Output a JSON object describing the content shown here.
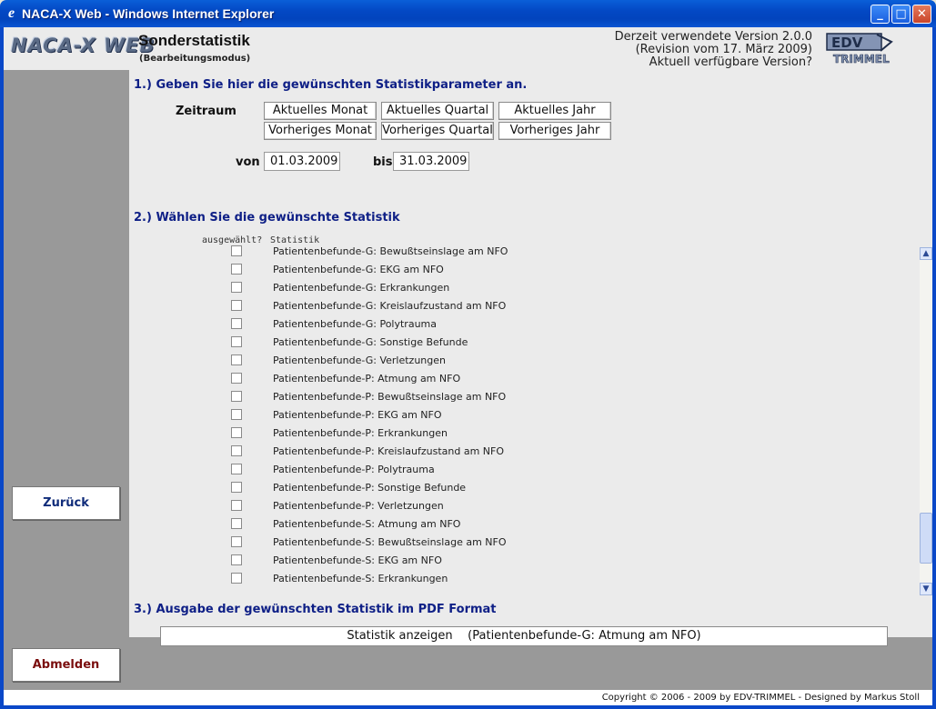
{
  "window": {
    "title": "NACA-X Web - Windows Internet Explorer"
  },
  "header": {
    "logo_text": "NACA-X WEB",
    "title": "Sonderstatistik",
    "subtitle": "(Bearbeitungsmodus)",
    "version_line1": "Derzeit verwendete Version 2.0.0",
    "version_line2": "(Revision vom 17. März 2009)",
    "version_line3": "Aktuell verfügbare Version?",
    "edv_logo_text": "EDV",
    "edv_logo_sub": "TRIMMEL"
  },
  "sidebar": {
    "back_label": "Zurück",
    "logout_label": "Abmelden"
  },
  "section1": {
    "heading": "1.) Geben Sie hier die gewünschten Statistikparameter an.",
    "zeitraum_label": "Zeitraum",
    "buttons": {
      "current_month": "Aktuelles Monat",
      "current_quarter": "Aktuelles Quartal",
      "current_year": "Aktuelles Jahr",
      "prev_month": "Vorheriges Monat",
      "prev_quarter": "Vorheriges Quartal",
      "prev_year": "Vorheriges Jahr"
    },
    "from_label": "von",
    "from_value": "01.03.2009",
    "to_label": "bis",
    "to_value": "31.03.2009"
  },
  "section2": {
    "heading": "2.) Wählen Sie die gewünschte Statistik",
    "col_selected": "ausgewählt?",
    "col_stat": "Statistik",
    "items": [
      "Patientenbefunde-G: Bewußtseinslage am NFO",
      "Patientenbefunde-G: EKG am NFO",
      "Patientenbefunde-G: Erkrankungen",
      "Patientenbefunde-G: Kreislaufzustand am NFO",
      "Patientenbefunde-G: Polytrauma",
      "Patientenbefunde-G: Sonstige Befunde",
      "Patientenbefunde-G: Verletzungen",
      "Patientenbefunde-P: Atmung am NFO",
      "Patientenbefunde-P: Bewußtseinslage am NFO",
      "Patientenbefunde-P: EKG am NFO",
      "Patientenbefunde-P: Erkrankungen",
      "Patientenbefunde-P: Kreislaufzustand am NFO",
      "Patientenbefunde-P: Polytrauma",
      "Patientenbefunde-P: Sonstige Befunde",
      "Patientenbefunde-P: Verletzungen",
      "Patientenbefunde-S: Atmung am NFO",
      "Patientenbefunde-S: Bewußtseinslage am NFO",
      "Patientenbefunde-S: EKG am NFO",
      "Patientenbefunde-S: Erkrankungen"
    ]
  },
  "section3": {
    "heading": "3.) Ausgabe der gewünschten Statistik im PDF Format",
    "show_button": "Statistik anzeigen    (Patientenbefunde-G: Atmung am NFO)"
  },
  "footer": {
    "copyright": "Copyright © 2006 - 2009 by EDV-TRIMMEL - Designed by Markus Stoll"
  },
  "icons": {
    "ie": "ie-logo-icon",
    "minimize": "minimize-icon",
    "maximize": "maximize-icon",
    "close": "close-icon",
    "scroll_up": "arrow-up-icon",
    "scroll_down": "arrow-down-icon"
  }
}
